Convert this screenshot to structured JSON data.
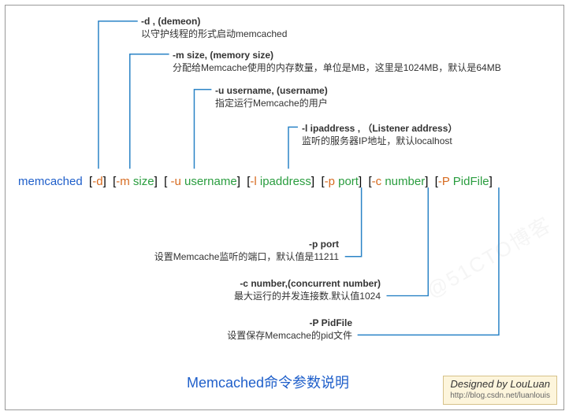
{
  "command": {
    "name": "memcached",
    "args": [
      {
        "bracket_open": "[",
        "flag": "-d",
        "value": "",
        "bracket_close": "]"
      },
      {
        "bracket_open": "[",
        "flag": "-m ",
        "value": "size",
        "bracket_close": "]"
      },
      {
        "bracket_open": "[ ",
        "flag": "-u ",
        "value": "username",
        "bracket_close": "]"
      },
      {
        "bracket_open": "[",
        "flag": "-l ",
        "value": "ipaddress",
        "bracket_close": "]"
      },
      {
        "bracket_open": "[",
        "flag": "-p ",
        "value": "port",
        "bracket_close": "]"
      },
      {
        "bracket_open": "[",
        "flag": "-c ",
        "value": "number",
        "bracket_close": "]"
      },
      {
        "bracket_open": "[",
        "flag": "-P ",
        "value": "PidFile",
        "bracket_close": "]"
      }
    ]
  },
  "notes": {
    "d": {
      "title": "-d ,    (demeon)",
      "desc": "以守护线程的形式启动memcached"
    },
    "m": {
      "title": "-m size,    (memory size)",
      "desc": "分配给Memcache使用的内存数量，单位是MB，这里是1024MB，默认是64MB"
    },
    "u": {
      "title": "-u username,    (username)",
      "desc": "指定运行Memcache的用户"
    },
    "l": {
      "title": "-l ipaddress ,   （Listener address）",
      "desc": "监听的服务器IP地址，默认localhost"
    },
    "p": {
      "title": "-p port",
      "desc": "设置Memcache监听的端口，默认值是11211"
    },
    "c": {
      "title": "-c number,(concurrent number)",
      "desc": "最大运行的并发连接数.默认值1024"
    },
    "P": {
      "title": "-P PidFile",
      "desc": "设置保存Memcache的pid文件"
    }
  },
  "caption": "Memcached命令参数说明",
  "credit": {
    "by": "Designed by LouLuan",
    "url": "http://blog.csdn.net/luanlouis"
  },
  "watermark": "@51CTO博客"
}
